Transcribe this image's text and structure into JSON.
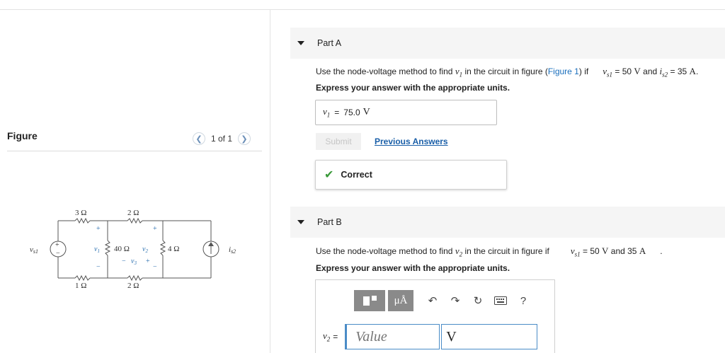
{
  "figure": {
    "title": "Figure",
    "pager": "1 of 1",
    "circuit": {
      "source_left": "v",
      "source_left_sub": "s1",
      "source_right": "i",
      "source_right_sub": "s2",
      "r_top_left": "3 Ω",
      "r_top_mid": "2 Ω",
      "r_mid": "40 Ω",
      "r_right": "4 Ω",
      "r_bot_left": "1 Ω",
      "r_bot_mid": "2 Ω",
      "v1": "v",
      "v1_sub": "1",
      "v2": "v",
      "v2_sub": "2",
      "v3": "v",
      "v3_sub": "3",
      "plus": "+",
      "minus": "−"
    }
  },
  "partA": {
    "title": "Part A",
    "question_pre": "Use the node-voltage method to find",
    "question_var": "v",
    "question_var_sub": "1",
    "question_mid": "in the circuit in figure (",
    "question_link": "Figure 1",
    "question_post": ") if",
    "given1_var": "v",
    "given1_sub": "s1",
    "given1_val": "= 50",
    "given1_unit": "V",
    "given_and": "and",
    "given2_var": "i",
    "given2_sub": "s2",
    "given2_val": "= 35",
    "given2_unit": "A",
    "given_end": ".",
    "instruction": "Express your answer with the appropriate units.",
    "answer_var": "v",
    "answer_sub": "1",
    "answer_eq": "=",
    "answer_value": "75.0",
    "answer_unit": "V",
    "submit_label": "Submit",
    "previous_label": "Previous Answers",
    "status": "Correct"
  },
  "partB": {
    "title": "Part B",
    "question_pre": "Use the node-voltage method to find",
    "question_var": "v",
    "question_var_sub": "2",
    "question_post": "in the circuit in figure if",
    "given1_var": "v",
    "given1_sub": "s1",
    "given1_val": "= 50",
    "given1_unit": "V",
    "given_and": "and 35",
    "given2_unit": "A",
    "given_end": ".",
    "instruction": "Express your answer with the appropriate units.",
    "toolbar": {
      "units_label": "μÅ",
      "help_label": "?"
    },
    "answer_var": "v",
    "answer_sub": "2",
    "answer_eq": "=",
    "value_placeholder": "Value",
    "unit_value": "V"
  },
  "colors": {
    "link": "#1a6fbd",
    "correct_check": "#3a9a3a",
    "input_border": "#4a8cc7",
    "part_header_bg": "#f5f5f5"
  },
  "icons": {
    "part_a_toggle": "triangle-down-icon",
    "part_b_toggle": "triangle-down-icon",
    "prev": "chevron-left-icon",
    "next": "chevron-right-icon",
    "check": "checkmark-icon",
    "templates": "templates-icon",
    "undo": "undo-icon",
    "redo": "redo-icon",
    "reset": "reset-icon",
    "keyboard": "keyboard-icon",
    "help": "help-icon"
  }
}
